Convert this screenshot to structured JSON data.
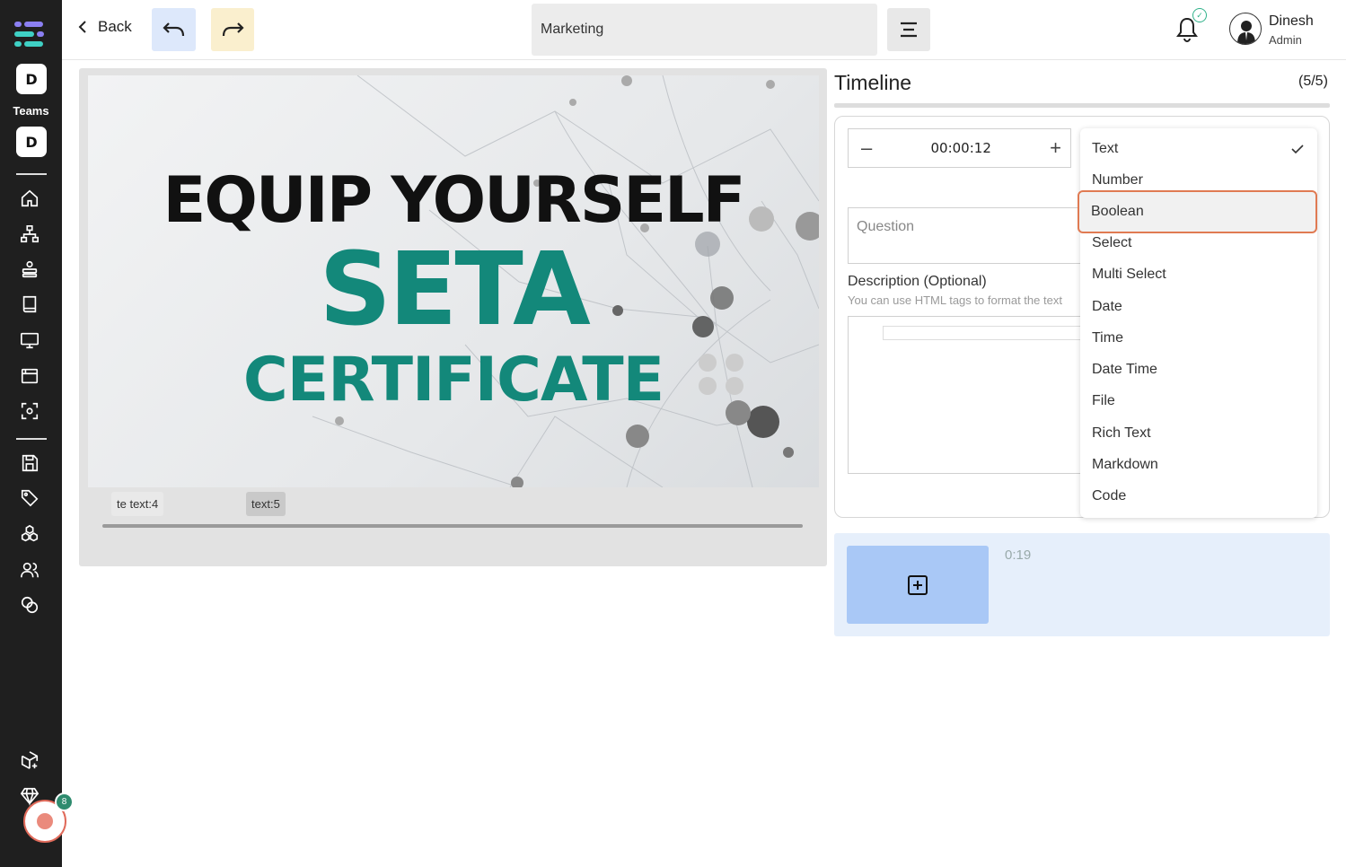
{
  "sidebar": {
    "team_badge_top": "D",
    "teams_label": "Teams",
    "team_badge_bottom": "D",
    "record_count": "8",
    "icons": [
      "home-icon",
      "sitemap-icon",
      "stack-icon",
      "book-icon",
      "monitor-icon",
      "browser-icon",
      "scan-icon",
      "save-icon",
      "tag-icon",
      "cubes-icon",
      "users-icon",
      "coins-icon",
      "box-plus-icon",
      "diamond-icon"
    ]
  },
  "topbar": {
    "back_label": "Back",
    "title_value": "Marketing",
    "user_name": "Dinesh",
    "user_role": "Admin"
  },
  "video": {
    "headline1": "EQUIP YOURSELF",
    "headline2": "SETA",
    "headline3": "CERTIFICATE",
    "chip1": "te text:4",
    "chip2": "text:5"
  },
  "timeline": {
    "title": "Timeline",
    "count": "(5/5)",
    "time_value": "00:00:12",
    "minus": "–",
    "plus": "+",
    "question_placeholder": "Question",
    "description_label": "Description (Optional)",
    "description_hint": "You can use HTML tags to format the text",
    "add_time": "0:19"
  },
  "dropdown": {
    "selected": "Text",
    "highlighted": "Boolean",
    "options": [
      "Text",
      "Number",
      "Boolean",
      "Select",
      "Multi Select",
      "Date",
      "Time",
      "Date Time",
      "File",
      "Rich Text",
      "Markdown",
      "Code"
    ]
  },
  "colors": {
    "sidebar_bg": "#1f1f1f",
    "brand_teal": "#13887a",
    "highlight_border": "#e07a52",
    "undo_bg": "#dde8fb",
    "redo_bg": "#faefce",
    "add_panel_bg": "#e6effb",
    "add_button_bg": "#a9c8f6"
  }
}
